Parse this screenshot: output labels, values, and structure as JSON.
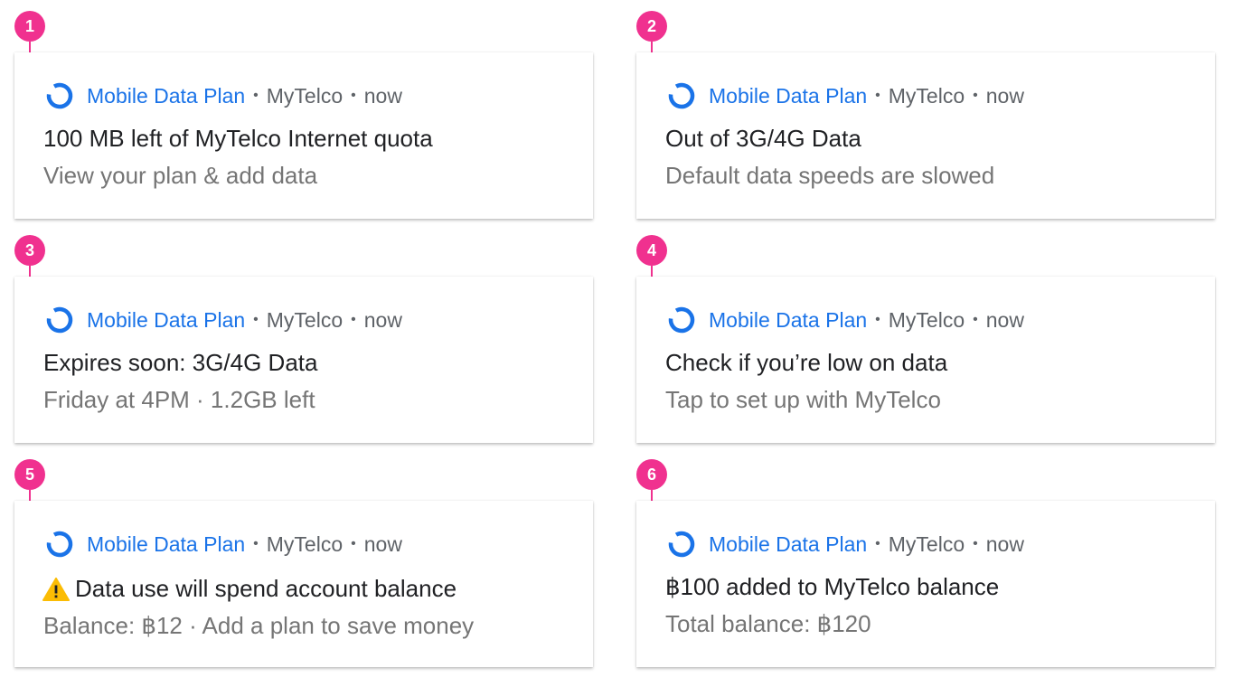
{
  "accent_color": "#1a73e8",
  "marker_color": "#f0318f",
  "notifications": [
    {
      "marker": "1",
      "app_icon": "data-plan-ring-icon",
      "app_name": "Mobile Data Plan",
      "separator": "•",
      "provider": "MyTelco",
      "time": "now",
      "title": "100 MB left of MyTelco Internet quota",
      "body": "View your plan & add data"
    },
    {
      "marker": "2",
      "app_icon": "data-plan-ring-icon",
      "app_name": "Mobile Data Plan",
      "separator": "•",
      "provider": "MyTelco",
      "time": "now",
      "title": "Out of 3G/4G Data",
      "body": "Default data speeds are slowed"
    },
    {
      "marker": "3",
      "app_icon": "data-plan-ring-icon",
      "app_name": "Mobile Data Plan",
      "separator": "•",
      "provider": "MyTelco",
      "time": "now",
      "title": "Expires soon: 3G/4G Data",
      "body": "Friday at 4PM · 1.2GB left"
    },
    {
      "marker": "4",
      "app_icon": "data-plan-ring-icon",
      "app_name": "Mobile Data Plan",
      "separator": "•",
      "provider": "MyTelco",
      "time": "now",
      "title": "Check if you’re low on data",
      "body": "Tap to set up with MyTelco"
    },
    {
      "marker": "5",
      "app_icon": "data-plan-ring-icon",
      "app_name": "Mobile Data Plan",
      "separator": "•",
      "provider": "MyTelco",
      "time": "now",
      "title_icon": "warning-icon",
      "title": "Data use will spend account balance",
      "body": "Balance: ฿12 · Add a plan to save money"
    },
    {
      "marker": "6",
      "app_icon": "data-plan-ring-icon",
      "app_name": "Mobile Data Plan",
      "separator": "•",
      "provider": "MyTelco",
      "time": "now",
      "title": "฿100 added to MyTelco balance",
      "body": "Total balance: ฿120"
    }
  ]
}
